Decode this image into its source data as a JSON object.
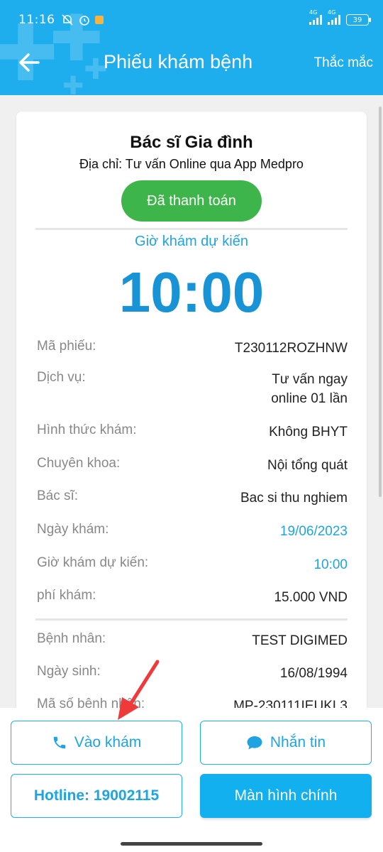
{
  "status_bar": {
    "time": "11:16",
    "network_1": "4G",
    "network_2": "4G",
    "battery": "39"
  },
  "header": {
    "title": "Phiếu khám bệnh",
    "faq": "Thắc mắc",
    "back_icon": "arrow-left-icon",
    "background_color": "#1eaeee"
  },
  "ticket": {
    "hospital": "Bác sĩ Gia đình",
    "address": "Địa chỉ: Tư vấn Online qua App Medpro",
    "status": "Đã thanh toán",
    "status_color": "#3db54a",
    "expected_label": "Giờ khám dự kiến",
    "expected_time": "10:00",
    "details": [
      {
        "label": "Mã phiếu:",
        "value": "T230112ROZHNW"
      },
      {
        "label": "Dịch vụ:",
        "value_line1": "Tư vấn ngay",
        "value_line2": "online 01 lần"
      },
      {
        "label": "Hình thức khám:",
        "value": "Không BHYT"
      },
      {
        "label": "Chuyên khoa:",
        "value": "Nội tổng quát"
      },
      {
        "label": "Bác sĩ:",
        "value": "Bac si thu nghiem"
      },
      {
        "label": "Ngày khám:",
        "value": "19/06/2023"
      },
      {
        "label": "Giờ khám dự kiến:",
        "value": "10:00"
      },
      {
        "label": "phí khám:",
        "value": "15.000 VND"
      }
    ],
    "patient": [
      {
        "label": "Bệnh nhân:",
        "value": "TEST DIGIMED"
      },
      {
        "label": "Ngày sinh:",
        "value": "16/08/1994"
      },
      {
        "label": "Mã số bệnh nhân:",
        "value": "MP-230111IEUKL3"
      }
    ]
  },
  "actions": {
    "call_label": "Vào khám",
    "call_icon": "phone-icon",
    "message_label": "Nhắn tin",
    "message_icon": "chat-bubble-icon",
    "hotline_label": "Hotline: 19002115",
    "home_label": "Màn hình chính"
  },
  "colors": {
    "accent": "#1ea4e2",
    "annotation_arrow": "#f03a3a"
  }
}
